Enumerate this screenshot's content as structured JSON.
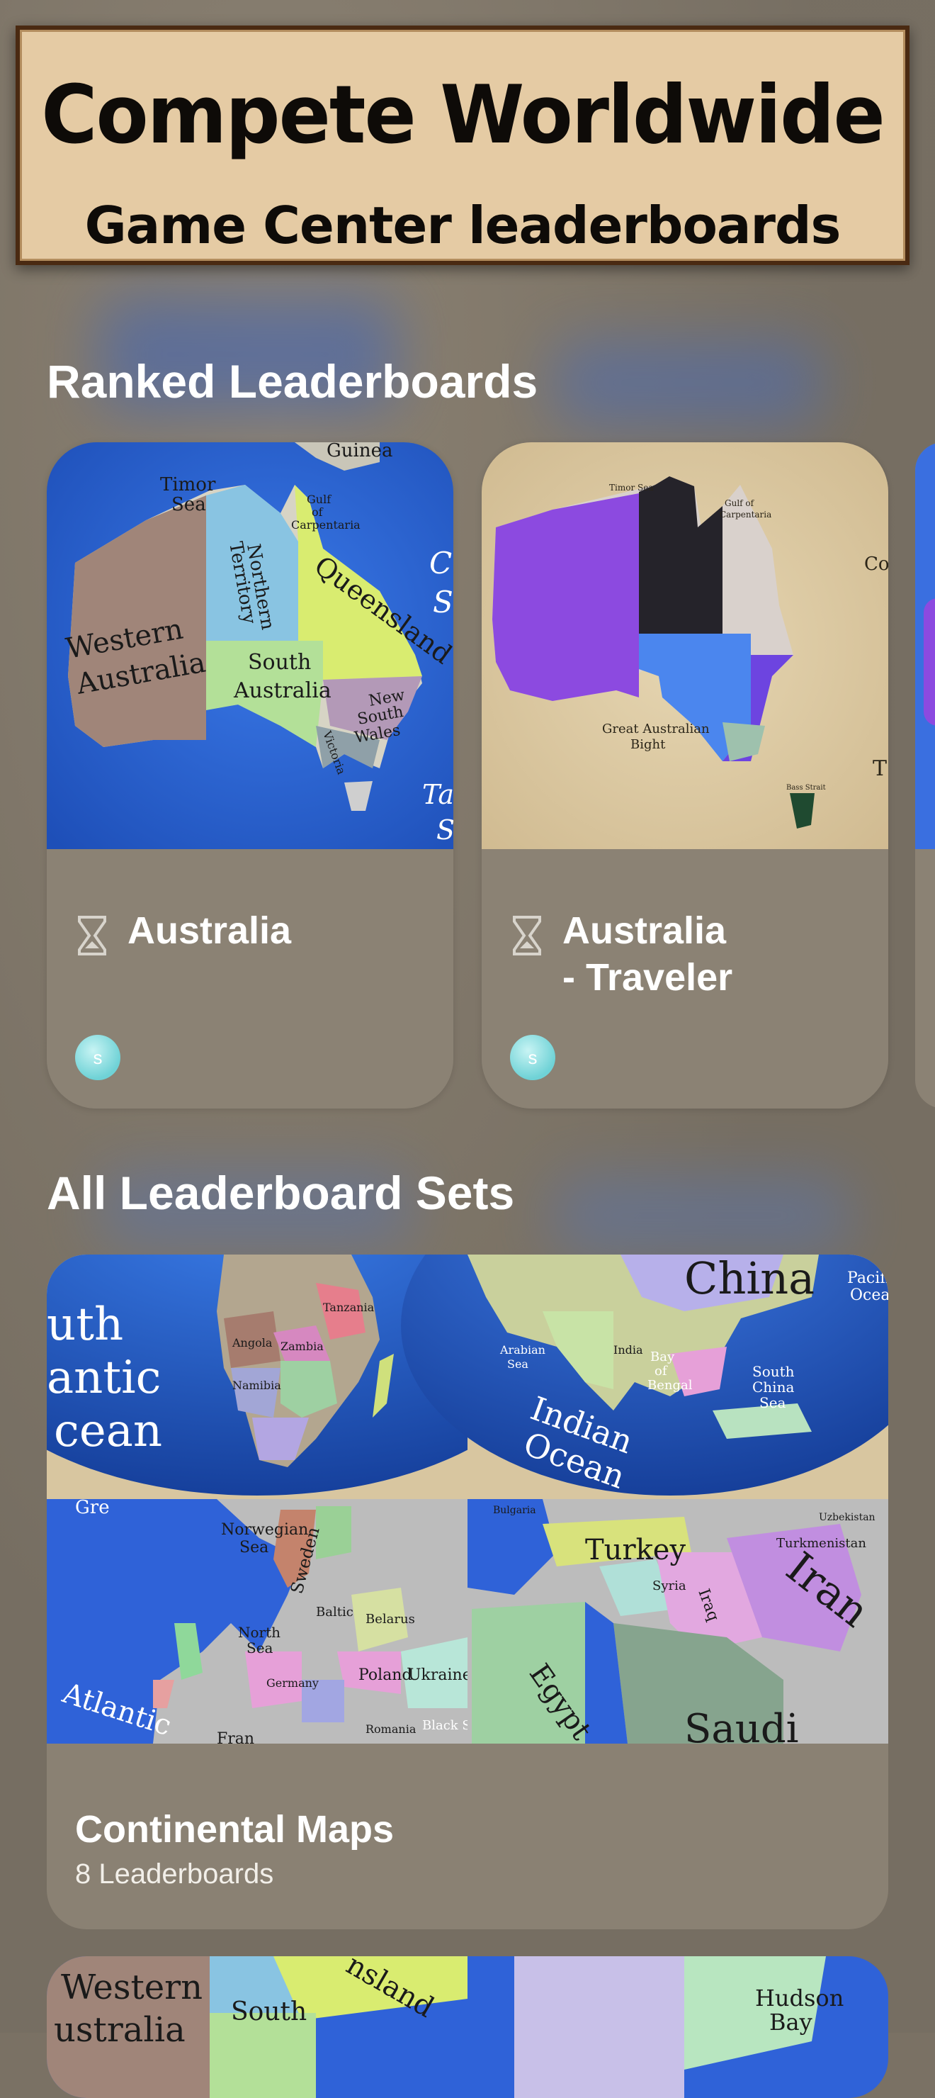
{
  "banner": {
    "title": "Compete Worldwide",
    "subtitle": "Game Center leaderboards"
  },
  "ranked_section": {
    "title": "Ranked Leaderboards",
    "cards": [
      {
        "name": "Australia",
        "icon": "hourglass-icon",
        "player_initial": "s"
      },
      {
        "name": "Australia\n- Traveler",
        "icon": "hourglass-icon",
        "player_initial": "s"
      }
    ]
  },
  "sets_section": {
    "title": "All Leaderboard Sets",
    "cards": [
      {
        "name": "Continental Maps",
        "count": "8 Leaderboards"
      }
    ]
  },
  "map_labels": {
    "australia": {
      "guinea": "Guinea",
      "timor": "Timor",
      "sea": "Sea",
      "gulf": "Gulf",
      "of": "of",
      "carpentaria": "Carpentaria",
      "northern": "Northern",
      "territory": "Territory",
      "queensland": "Queensland",
      "western": "Western",
      "australia": "Australia",
      "south": "South",
      "new": "New",
      "wales": "Wales",
      "victoria": "Victoria",
      "coral_c": "C",
      "coral_s": "S",
      "tas_t": "Ta",
      "tas_s": "S"
    },
    "traveler": {
      "timor_sea": "Timor Sea",
      "gulf": "Gulf of",
      "carpentaria": "Carpentaria",
      "great": "Great Australian",
      "bight": "Bight",
      "bass": "Bass Strait",
      "co": "Co",
      "t": "T"
    },
    "collage": {
      "south": "uth",
      "atlantic": "antic",
      "ocean": "cean",
      "china": "China",
      "indian": "Indian",
      "indian_ocean": "Ocean",
      "arabian": "Arabian",
      "arabian_sea": "Sea",
      "bay": "Bay",
      "of": "of",
      "bengal": "Bengal",
      "south_china": "South",
      "china_sea": "China",
      "china_sea2": "Sea",
      "pacific": "Pacifi",
      "pacific2": "Ocea",
      "india": "India",
      "angola": "Angola",
      "zambia": "Zambia",
      "tanzania": "Tanzania",
      "namibia": "Namibia",
      "norwegian": "Norwegian",
      "norwegian_sea": "Sea",
      "north": "North",
      "north_sea": "Sea",
      "sweden": "Sweden",
      "baltic": "Baltic",
      "poland": "Poland",
      "ukraine": "Ukraine",
      "germany": "Germany",
      "atlantic2": "Atlantic",
      "black_sea": "Black Sea",
      "romania": "Romania",
      "belarus": "Belarus",
      "turkey": "Turkey",
      "iran": "Iran",
      "iraq": "Iraq",
      "syria": "Syria",
      "egypt": "Egypt",
      "saudi": "Saudi",
      "turkmenistan": "Turkmenistan",
      "uzbekistan": "Uzbekistan",
      "bulgaria": "Bulgaria",
      "gre": "Gre",
      "fran": "Fran"
    },
    "peek": {
      "western": "Western",
      "australia": "ustralia",
      "south": "South",
      "queensland": "nsland",
      "hudson": "Hudson",
      "bay": "Bay"
    }
  }
}
